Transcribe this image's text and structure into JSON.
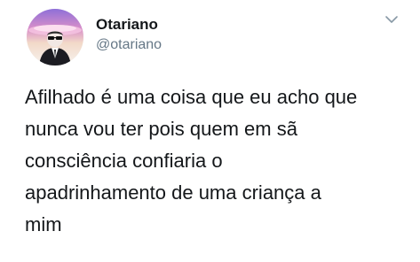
{
  "user": {
    "display_name": "Otariano",
    "handle": "@otariano",
    "avatar_icon": "profile-avatar"
  },
  "menu": {
    "icon": "chevron-down-icon"
  },
  "tweet": {
    "lines": [
      "Afilhado é uma coisa que eu acho que",
      "nunca vou ter pois quem em sã",
      "consciência confiaria o",
      "apadrinhamento de uma criança a",
      "mim"
    ]
  },
  "colors": {
    "text_primary": "#14171a",
    "text_secondary": "#657786",
    "background": "#ffffff"
  }
}
